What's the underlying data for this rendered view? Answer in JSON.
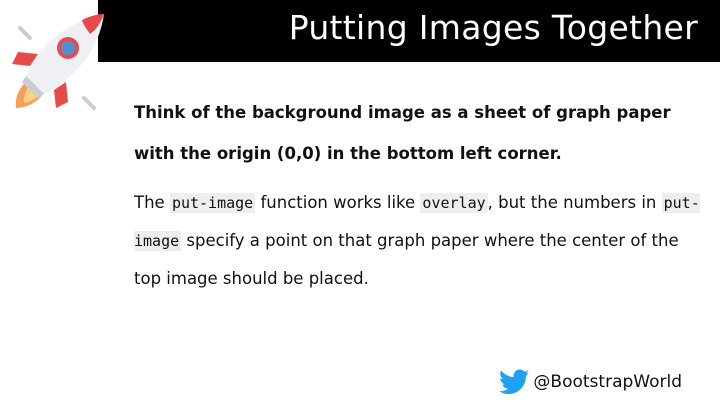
{
  "slide": {
    "title": "Putting Images Together",
    "paragraph1": "Think of the background image as a sheet of graph paper with the origin (0,0) in the bottom left corner.",
    "paragraph2": {
      "part1": "The ",
      "code1": "put-image",
      "part2": " function works like ",
      "code2": "overlay",
      "part3": ", but the numbers in ",
      "code3": "put-image",
      "part4": " specify a point on that graph paper where the center of the top image should be placed."
    },
    "footer_handle": "@BootstrapWorld"
  },
  "icons": {
    "logo": "rocket-icon",
    "social": "twitter-bird-icon"
  },
  "colors": {
    "title_bar": "#000000",
    "title_text": "#ffffff",
    "twitter_blue": "#1da1f2",
    "rocket_red": "#e84a4a"
  }
}
